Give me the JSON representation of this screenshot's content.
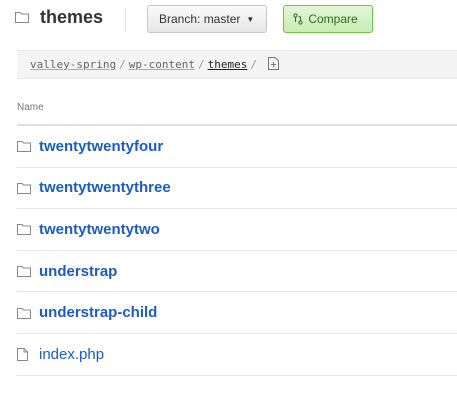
{
  "header": {
    "title": "themes",
    "title_icon": "folder-icon",
    "branch_label": "Branch: master",
    "caret": "▼",
    "compare_label": "Compare"
  },
  "breadcrumb": {
    "parts": [
      "valley-spring",
      "wp-content",
      "themes"
    ],
    "separator": "/",
    "new_file_icon": "new-file-icon"
  },
  "table": {
    "column_header": "Name"
  },
  "files": [
    {
      "name": "twentytwentyfour",
      "type": "dir",
      "icon": "folder-icon"
    },
    {
      "name": "twentytwentythree",
      "type": "dir",
      "icon": "folder-icon"
    },
    {
      "name": "twentytwentytwo",
      "type": "dir",
      "icon": "folder-icon"
    },
    {
      "name": "understrap",
      "type": "dir",
      "icon": "folder-icon"
    },
    {
      "name": "understrap-child",
      "type": "dir",
      "icon": "folder-icon"
    },
    {
      "name": "index.php",
      "type": "file",
      "icon": "file-icon"
    }
  ],
  "colors": {
    "link": "#1e5bbf",
    "compare_border": "#6cc644"
  }
}
